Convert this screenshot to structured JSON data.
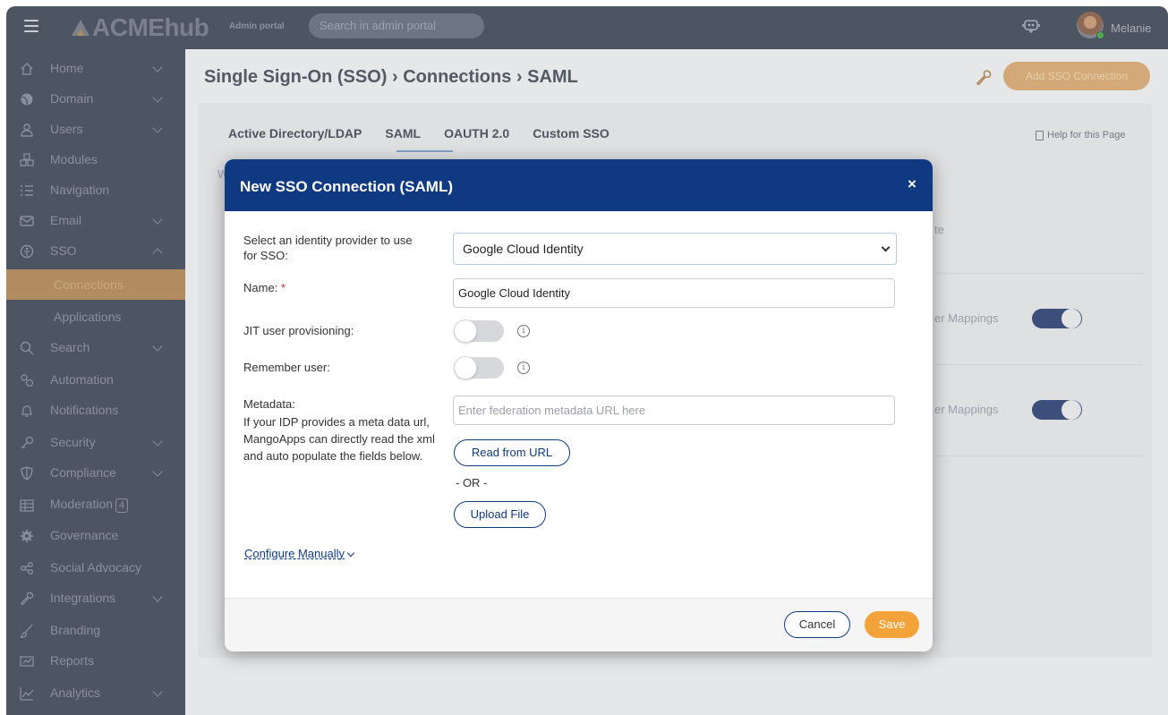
{
  "header": {
    "logo_text": "ACMEhub",
    "portal_label": "Admin portal",
    "search_placeholder": "Search in admin portal",
    "user_name": "Melanie"
  },
  "sidebar": {
    "items": [
      {
        "label": "Home",
        "icon": "home-icon"
      },
      {
        "label": "Domain",
        "icon": "globe-icon"
      },
      {
        "label": "Users",
        "icon": "user-icon"
      },
      {
        "label": "Modules",
        "icon": "modules-icon"
      },
      {
        "label": "Navigation",
        "icon": "list-icon"
      },
      {
        "label": "Email",
        "icon": "mail-icon"
      },
      {
        "label": "SSO",
        "icon": "sso-icon"
      },
      {
        "label": "Connections"
      },
      {
        "label": "Applications"
      },
      {
        "label": "Search",
        "icon": "search-icon"
      },
      {
        "label": "Automation",
        "icon": "gears-icon"
      },
      {
        "label": "Notifications",
        "icon": "bell-icon"
      },
      {
        "label": "Security",
        "icon": "key-icon"
      },
      {
        "label": "Compliance",
        "icon": "shield-icon"
      },
      {
        "label": "Moderation",
        "icon": "table-icon",
        "badge": "4"
      },
      {
        "label": "Governance",
        "icon": "gear-icon"
      },
      {
        "label": "Social Advocacy",
        "icon": "share-icon"
      },
      {
        "label": "Integrations",
        "icon": "wrench-icon"
      },
      {
        "label": "Branding",
        "icon": "brush-icon"
      },
      {
        "label": "Reports",
        "icon": "reports-icon"
      },
      {
        "label": "Analytics",
        "icon": "chart-icon"
      }
    ]
  },
  "main": {
    "breadcrumb": "Single Sign-On (SSO) › Connections › SAML",
    "add_button": "Add SSO Connection",
    "tabs": [
      "Active Directory/LDAP",
      "SAML",
      "OAUTH 2.0",
      "Custom SSO"
    ],
    "active_tab": "SAML",
    "help_link": "Help for this Page",
    "bg_fragments": {
      "w": "W",
      "te": "te",
      "mappings_1": "er Mappings",
      "mappings_2": "er Mappings"
    }
  },
  "modal": {
    "title": "New SSO Connection (SAML)",
    "close": "×",
    "idp_label": "Select an identity provider to use for SSO:",
    "idp_value": "Google Cloud Identity",
    "name_label": "Name:",
    "name_required": "*",
    "name_value": "Google Cloud Identity",
    "jit_label": "JIT user provisioning:",
    "remember_label": "Remember user:",
    "metadata_label": "Metadata:",
    "metadata_help": "If your IDP provides a meta data url, MangoApps can directly read the xml and auto populate the fields below.",
    "metadata_placeholder": "Enter federation metadata URL here",
    "read_button": "Read from URL",
    "or_text": "- OR -",
    "upload_button": "Upload File",
    "configure_link": "Configure Manually",
    "cancel_button": "Cancel",
    "save_button": "Save",
    "jit_enabled": false,
    "remember_enabled": false
  },
  "colors": {
    "sidebar": "#4d5563",
    "modal_header": "#0f3a82",
    "accent": "#f3a33a",
    "active_item": "#b08c60"
  }
}
